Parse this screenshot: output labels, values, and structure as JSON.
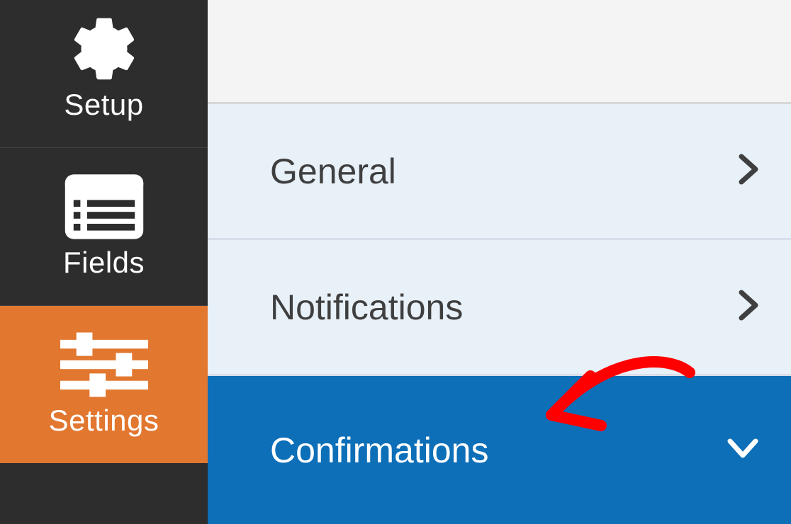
{
  "sidebar": {
    "items": [
      {
        "id": "setup",
        "label": "Setup",
        "active": false
      },
      {
        "id": "fields",
        "label": "Fields",
        "active": false
      },
      {
        "id": "settings",
        "label": "Settings",
        "active": true
      }
    ]
  },
  "panels": [
    {
      "id": "general",
      "label": "General",
      "expanded": false
    },
    {
      "id": "notifications",
      "label": "Notifications",
      "expanded": false
    },
    {
      "id": "confirmations",
      "label": "Confirmations",
      "expanded": true
    }
  ],
  "colors": {
    "sidebar_bg": "#2d2d2d",
    "accent_orange": "#e27730",
    "panel_selected": "#0d6fb8",
    "panel_bg": "#e8f0f8",
    "annotation_red": "#ff0000"
  }
}
